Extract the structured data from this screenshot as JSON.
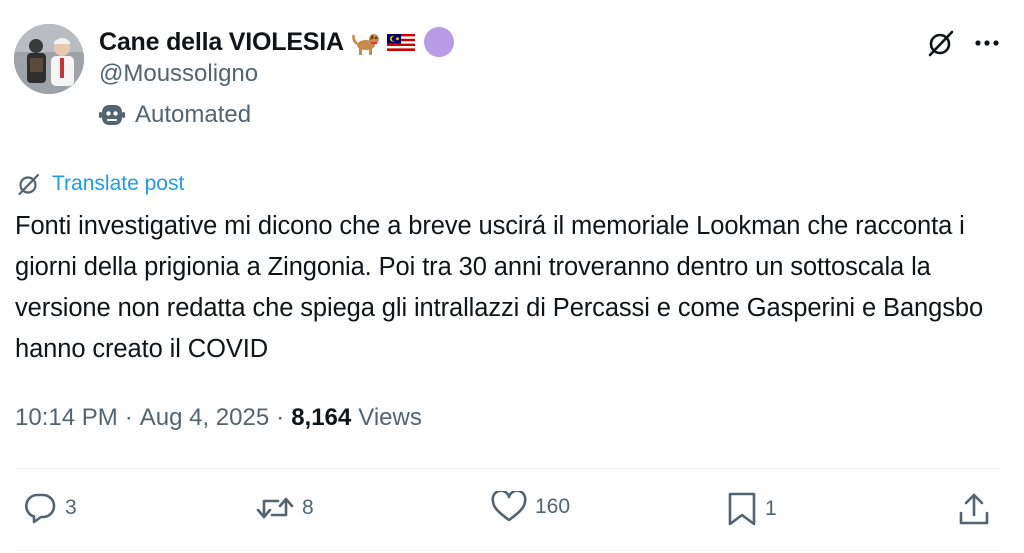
{
  "author": {
    "display_name": "Cane della VIOLESIA",
    "handle": "@Moussoligno",
    "label": "Automated",
    "badges": [
      "dog-emoji",
      "malaysia-flag-emoji",
      "purple-circle-emoji"
    ]
  },
  "translate": {
    "label": "Translate post"
  },
  "post": {
    "text": "Fonti investigative mi dicono che a breve uscirá il memoriale Lookman che racconta i giorni della prigionia a Zingonia. Poi tra 30 anni troveranno dentro un sottoscala la versione non redatta che spiega gli intrallazzi di Percassi e come Gasperini e Bangsbo hanno creato il COVID"
  },
  "meta": {
    "time": "10:14 PM",
    "date": "Aug 4, 2025",
    "separator": "·",
    "views_count": "8,164",
    "views_label": "Views"
  },
  "actions": {
    "replies": "3",
    "reposts": "8",
    "likes": "160",
    "bookmarks": "1"
  },
  "colors": {
    "text": "#0f1419",
    "secondary": "#536471",
    "link": "#1d9bf0",
    "divider": "#eff3f4"
  }
}
